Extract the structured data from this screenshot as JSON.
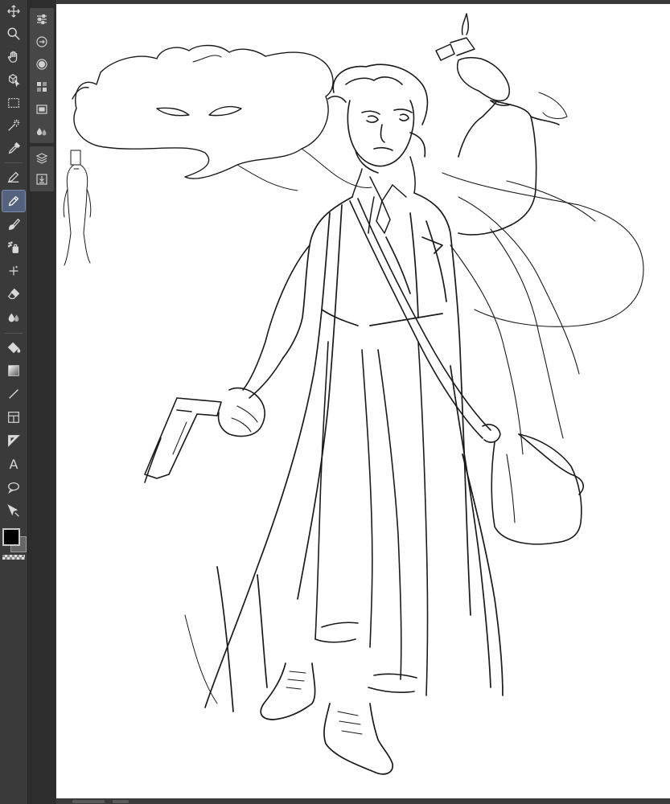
{
  "app": {
    "accent_color": "#54627f",
    "background_color": "#333333",
    "canvas_color": "#ffffff"
  },
  "toolbar": {
    "tools": [
      {
        "name": "move-icon",
        "active": false
      },
      {
        "name": "zoom-icon",
        "active": false
      },
      {
        "name": "hand-icon",
        "active": false
      },
      {
        "name": "object-select-icon",
        "active": false
      },
      {
        "name": "rect-select-icon",
        "active": false
      },
      {
        "name": "auto-select-icon",
        "active": false
      },
      {
        "name": "eyedropper-icon",
        "active": false
      },
      {
        "name": "pen-icon",
        "active": false
      },
      {
        "name": "pencil-icon",
        "active": true
      },
      {
        "name": "brush-icon",
        "active": false
      },
      {
        "name": "airbrush-icon",
        "active": false
      },
      {
        "name": "decoration-icon",
        "active": false
      },
      {
        "name": "eraser-icon",
        "active": false
      },
      {
        "name": "blend-icon",
        "active": false
      },
      {
        "name": "fill-icon",
        "active": false
      },
      {
        "name": "gradient-icon",
        "active": false
      },
      {
        "name": "line-icon",
        "active": false
      },
      {
        "name": "frame-icon",
        "active": false
      },
      {
        "name": "ruler-icon",
        "active": false
      },
      {
        "name": "text-icon",
        "active": false
      },
      {
        "name": "balloon-icon",
        "active": false
      },
      {
        "name": "correct-line-icon",
        "active": false
      }
    ],
    "text_tool_glyph": "A",
    "foreground_color": "#000000",
    "background_color": "#666666"
  },
  "subtool_bar": {
    "icons": [
      "tool-property-icon",
      "subtool-icon",
      "color-wheel-icon",
      "color-set-icon",
      "navigator-icon",
      "blend-drops-icon",
      "layers-icon",
      "layer-import-icon"
    ]
  }
}
